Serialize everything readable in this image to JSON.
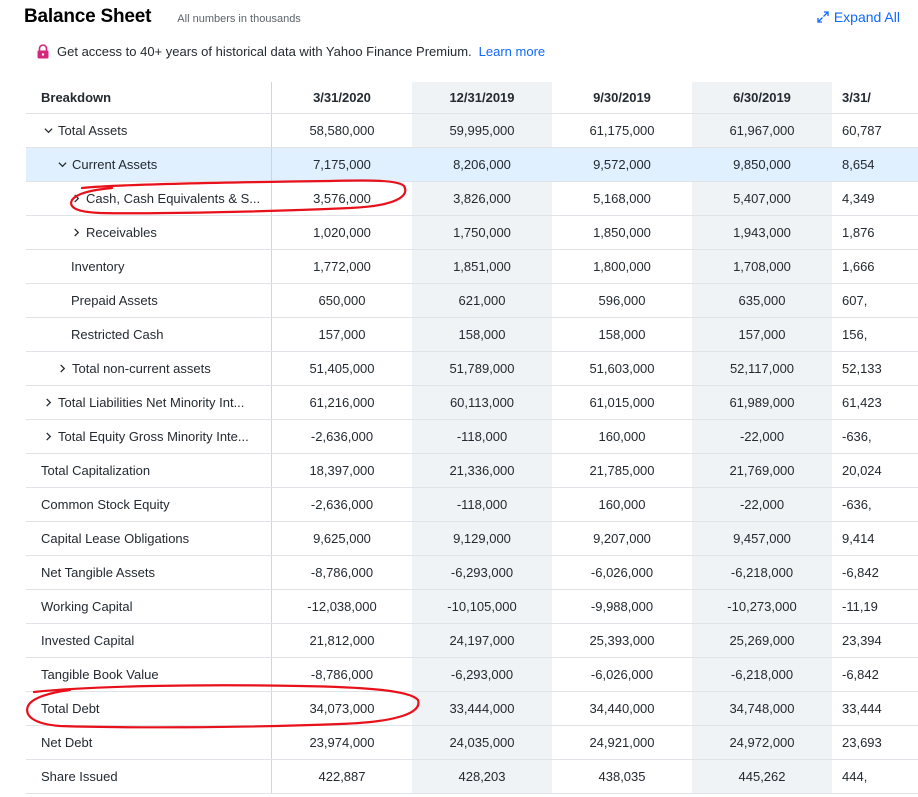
{
  "header": {
    "title": "Balance Sheet",
    "subtitle": "All numbers in thousands",
    "expand_label": "Expand All"
  },
  "premium": {
    "text": "Get access to 40+ years of historical data with Yahoo Finance Premium.",
    "link": "Learn more"
  },
  "table": {
    "breakdown_label": "Breakdown",
    "columns": [
      "3/31/2020",
      "12/31/2019",
      "9/30/2019",
      "6/30/2019",
      "3/31/"
    ],
    "rows": [
      {
        "label": "Total Assets",
        "values": [
          "58,580,000",
          "59,995,000",
          "61,175,000",
          "61,967,000",
          "60,787"
        ]
      },
      {
        "label": "Current Assets",
        "values": [
          "7,175,000",
          "8,206,000",
          "9,572,000",
          "9,850,000",
          "8,654"
        ]
      },
      {
        "label": "Cash, Cash Equivalents & S...",
        "values": [
          "3,576,000",
          "3,826,000",
          "5,168,000",
          "5,407,000",
          "4,349"
        ]
      },
      {
        "label": "Receivables",
        "values": [
          "1,020,000",
          "1,750,000",
          "1,850,000",
          "1,943,000",
          "1,876"
        ]
      },
      {
        "label": "Inventory",
        "values": [
          "1,772,000",
          "1,851,000",
          "1,800,000",
          "1,708,000",
          "1,666"
        ]
      },
      {
        "label": "Prepaid Assets",
        "values": [
          "650,000",
          "621,000",
          "596,000",
          "635,000",
          "607,"
        ]
      },
      {
        "label": "Restricted Cash",
        "values": [
          "157,000",
          "158,000",
          "158,000",
          "157,000",
          "156,"
        ]
      },
      {
        "label": "Total non-current assets",
        "values": [
          "51,405,000",
          "51,789,000",
          "51,603,000",
          "52,117,000",
          "52,133"
        ]
      },
      {
        "label": "Total Liabilities Net Minority Int...",
        "values": [
          "61,216,000",
          "60,113,000",
          "61,015,000",
          "61,989,000",
          "61,423"
        ]
      },
      {
        "label": "Total Equity Gross Minority Inte...",
        "values": [
          "-2,636,000",
          "-118,000",
          "160,000",
          "-22,000",
          "-636,"
        ]
      },
      {
        "label": "Total Capitalization",
        "values": [
          "18,397,000",
          "21,336,000",
          "21,785,000",
          "21,769,000",
          "20,024"
        ]
      },
      {
        "label": "Common Stock Equity",
        "values": [
          "-2,636,000",
          "-118,000",
          "160,000",
          "-22,000",
          "-636,"
        ]
      },
      {
        "label": "Capital Lease Obligations",
        "values": [
          "9,625,000",
          "9,129,000",
          "9,207,000",
          "9,457,000",
          "9,414"
        ]
      },
      {
        "label": "Net Tangible Assets",
        "values": [
          "-8,786,000",
          "-6,293,000",
          "-6,026,000",
          "-6,218,000",
          "-6,842"
        ]
      },
      {
        "label": "Working Capital",
        "values": [
          "-12,038,000",
          "-10,105,000",
          "-9,988,000",
          "-10,273,000",
          "-11,19"
        ]
      },
      {
        "label": "Invested Capital",
        "values": [
          "21,812,000",
          "24,197,000",
          "25,393,000",
          "25,269,000",
          "23,394"
        ]
      },
      {
        "label": "Tangible Book Value",
        "values": [
          "-8,786,000",
          "-6,293,000",
          "-6,026,000",
          "-6,218,000",
          "-6,842"
        ]
      },
      {
        "label": "Total Debt",
        "values": [
          "34,073,000",
          "33,444,000",
          "34,440,000",
          "34,748,000",
          "33,444"
        ]
      },
      {
        "label": "Net Debt",
        "values": [
          "23,974,000",
          "24,035,000",
          "24,921,000",
          "24,972,000",
          "23,693"
        ]
      },
      {
        "label": "Share Issued",
        "values": [
          "422,887",
          "428,203",
          "438,035",
          "445,262",
          "444,"
        ]
      }
    ]
  },
  "colors": {
    "link": "#0f69ff",
    "highlight_row": "#e0f0ff",
    "annotation": "#e8101a"
  }
}
